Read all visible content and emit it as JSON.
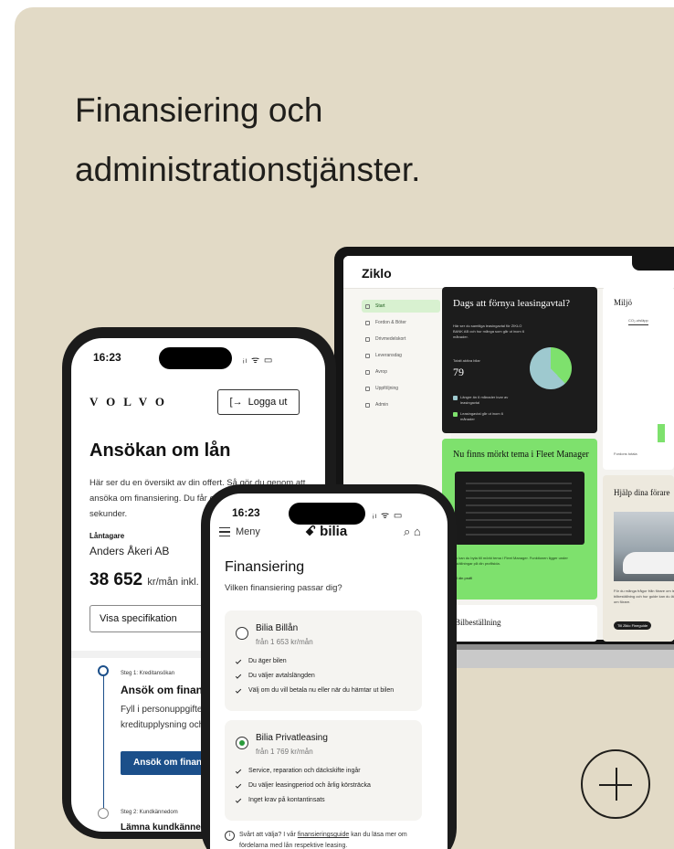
{
  "headline": "Finansiering och administrationstjänster.",
  "laptop": {
    "logo": "Ziklo",
    "nav": [
      "Start",
      "Fordon & Böter",
      "Drivmedelskort",
      "Leveransdag",
      "Avrop",
      "Uppföljning",
      "Admin"
    ],
    "renewal": {
      "title": "Dags att förnya leasingavtal?",
      "text": "Här ser du samtliga leasingavtal för ZIKLO BANK AB och hur många som går ut inom 6 månader.",
      "total_label": "Totalt aktiva bilar",
      "total_value": "79",
      "legend": [
        "Längre än 6 månader kvar av leasingavtal",
        "Leasingavtal går ut inom 6 månader"
      ]
    },
    "dark_theme": {
      "title": "Nu finns mörkt tema i Fleet Manager",
      "text": "Nu kan du byta till mörkt tema i Fleet Manager. Funktionen ligger under Inställningar på din profilsida.",
      "link": "Till din profil"
    },
    "order": {
      "title": "Bilbeställning"
    },
    "environment": {
      "title": "Miljö",
      "tab": "CO₂-utsläpp",
      "footer": "Fordons totala"
    },
    "help": {
      "title": "Hjälp dina förare",
      "text": "För du många frågor från förare om leasing, bilbeställning och hur guide kan du läsa mer om förare.",
      "button": "Till Ziklo Fineguide"
    },
    "colors": {
      "green": "#7ee16d",
      "teal": "#9ec9cf"
    }
  },
  "volvo_phone": {
    "time": "16:23",
    "status": "ᵢₗ ᯤ ▭",
    "brand": "VOLVO",
    "logout": "Logga ut",
    "title": "Ansökan om lån",
    "description": "Här ser du en översikt av din offert. Så gör du genom att ansöka om finansiering. Du får ett kreditbeslut inom några sekunder.",
    "borrower_label": "Låntagare",
    "borrower": "Anders Åkeri AB",
    "amount": "38 652",
    "amount_unit": "kr/mån inkl. moms",
    "spec_button": "Visa specifikation",
    "step1_label": "Steg 1: Kreditansökan",
    "step1_title": "Ansök om finansiering",
    "step1_text": "Fyll i personuppgifter för att kunna göra kreditupplysning och skicka in din ansökan.",
    "step1_button": "Ansök om finansiering",
    "step2_label": "Steg 2: Kundkännedom",
    "step2_title": "Lämna kundkännedom"
  },
  "bilia_phone": {
    "time": "16:23",
    "status": "ᵢₗ ᯤ ▭",
    "menu": "Meny",
    "logo": "bilia",
    "title": "Finansiering",
    "subtitle": "Vilken finansiering passar dig?",
    "options": [
      {
        "title": "Bilia Billån",
        "price": "från 1 653 kr/mån",
        "selected": false,
        "features": [
          "Du äger bilen",
          "Du väljer avtalslängden",
          "Välj om du vill betala nu eller när du hämtar ut bilen"
        ]
      },
      {
        "title": "Bilia Privatleasing",
        "price": "från 1 769 kr/mån",
        "selected": true,
        "features": [
          "Service, reparation och däckskifte ingår",
          "Du väljer leasingperiod och årlig körsträcka",
          "Inget krav på kontantinsats"
        ]
      }
    ],
    "info_pre": "Svårt att välja? I vår ",
    "info_link": "finansieringsguide",
    "info_post": " kan du läsa mer om fördelarna med lån respektive leasing."
  }
}
